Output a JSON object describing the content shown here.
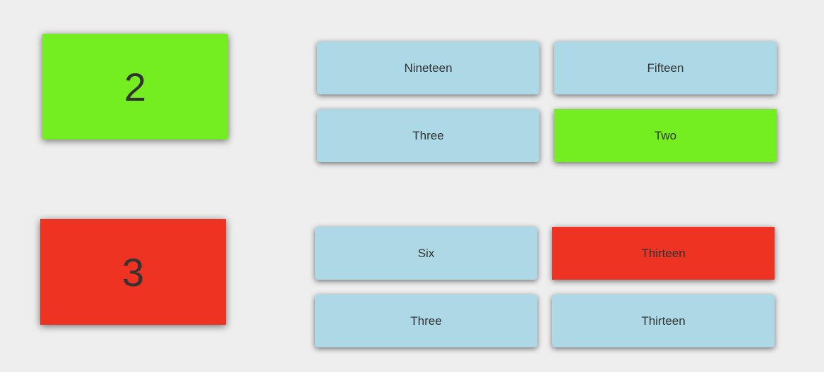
{
  "colors": {
    "correct": "#75ee21",
    "wrong": "#ee3322",
    "neutral": "#add8e6",
    "background": "#eeeeee"
  },
  "questions": [
    {
      "number": "2",
      "state": "correct",
      "options": [
        {
          "label": "Nineteen",
          "state": "neutral"
        },
        {
          "label": "Fifteen",
          "state": "neutral"
        },
        {
          "label": "Three",
          "state": "neutral"
        },
        {
          "label": "Two",
          "state": "correct"
        }
      ]
    },
    {
      "number": "3",
      "state": "wrong",
      "options": [
        {
          "label": "Six",
          "state": "neutral"
        },
        {
          "label": "Thirteen",
          "state": "wrong"
        },
        {
          "label": "Three",
          "state": "neutral"
        },
        {
          "label": "Thirteen",
          "state": "neutral"
        }
      ]
    }
  ]
}
